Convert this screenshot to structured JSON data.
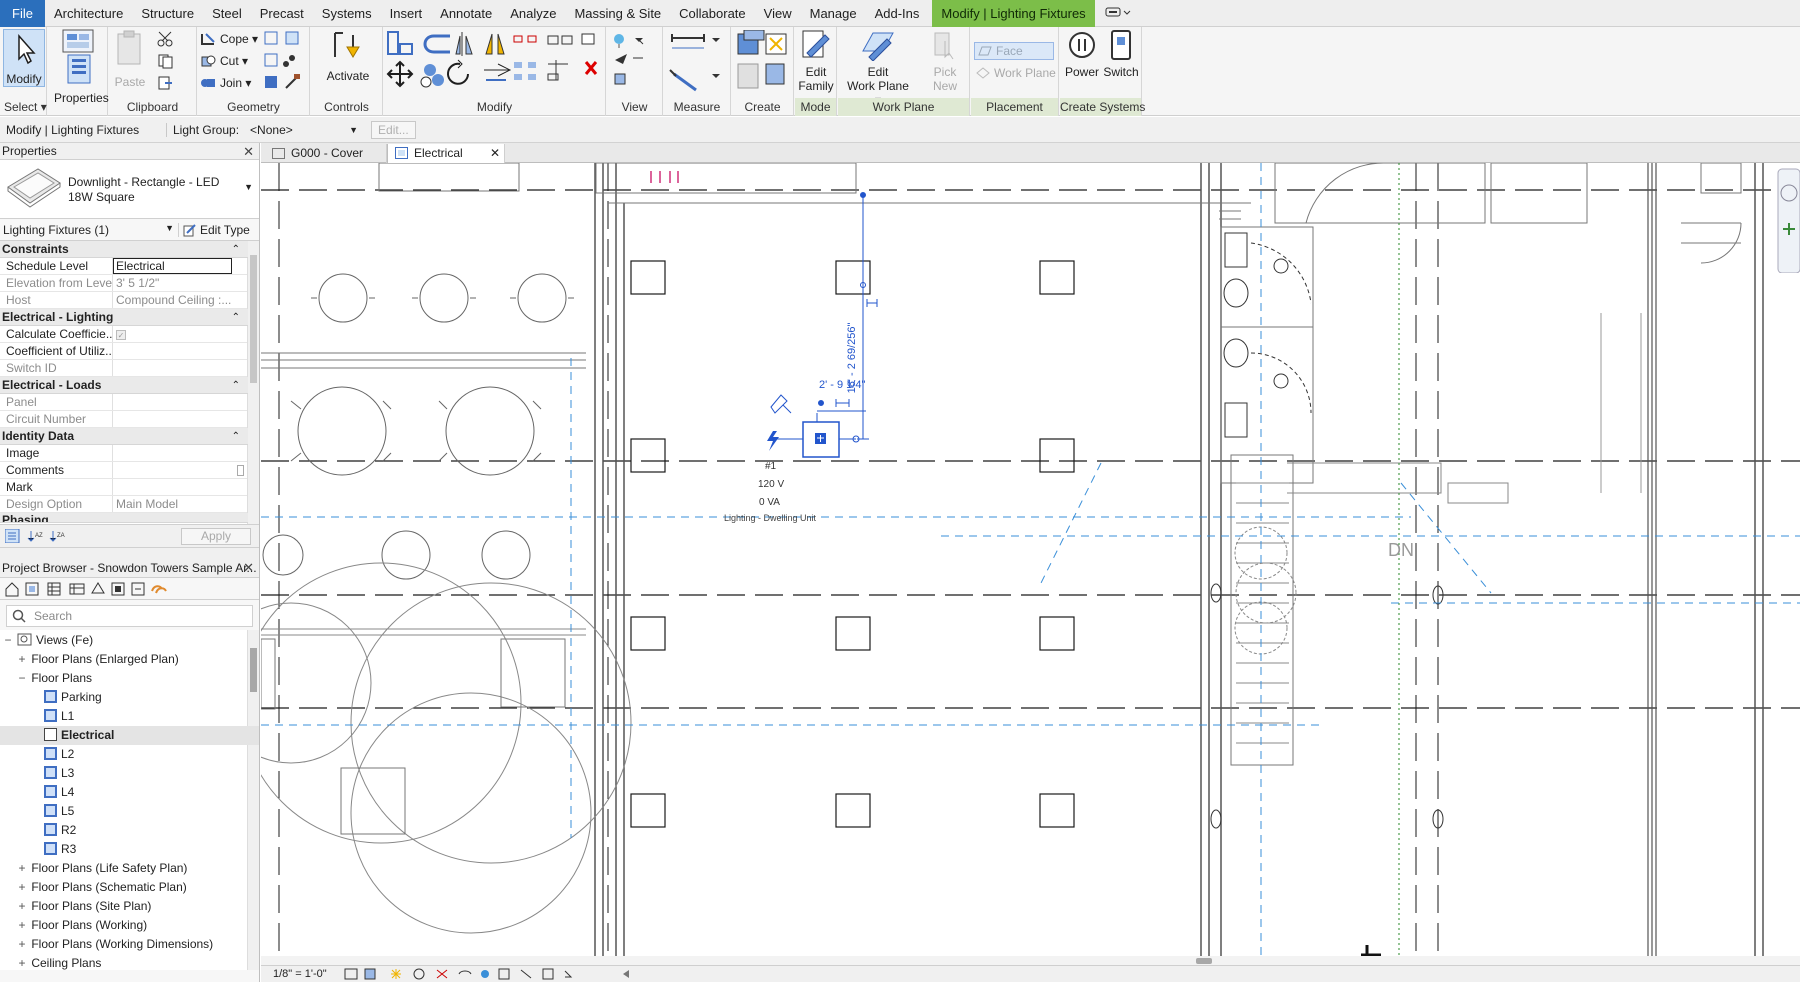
{
  "menu": {
    "tabs": [
      "File",
      "Architecture",
      "Structure",
      "Steel",
      "Precast",
      "Systems",
      "Insert",
      "Annotate",
      "Analyze",
      "Massing & Site",
      "Collaborate",
      "View",
      "Manage",
      "Add-Ins",
      "Modify | Lighting Fixtures"
    ]
  },
  "ribbon": {
    "select": {
      "modify": "Modify",
      "panel": "Select"
    },
    "properties": {
      "label": "Properties",
      "panel": "Properties"
    },
    "clipboard": {
      "paste": "Paste",
      "panel": "Clipboard"
    },
    "geometry": {
      "cope": "Cope",
      "cut": "Cut",
      "join": "Join",
      "panel": "Geometry"
    },
    "controls": {
      "activate": "Activate",
      "panel": "Controls"
    },
    "modify": {
      "panel": "Modify"
    },
    "view": {
      "panel": "View"
    },
    "measure": {
      "panel": "Measure"
    },
    "create": {
      "panel": "Create"
    },
    "mode": {
      "edit_family_1": "Edit",
      "edit_family_2": "Family",
      "panel": "Mode"
    },
    "workplane": {
      "edit_1": "Edit",
      "edit_2": "Work Plane",
      "pick_1": "Pick",
      "pick_2": "New",
      "panel": "Work Plane"
    },
    "placement": {
      "face": "Face",
      "work_plane": "Work Plane",
      "panel": "Placement"
    },
    "create_systems": {
      "power": "Power",
      "switch": "Switch",
      "panel": "Create Systems"
    }
  },
  "options_bar": {
    "context": "Modify | Lighting Fixtures",
    "light_group_label": "Light Group:",
    "light_group_value": "<None>",
    "edit_button": "Edit..."
  },
  "properties": {
    "title": "Properties",
    "type_name_1": "Downlight - Rectangle - LED",
    "type_name_2": "18W Square",
    "filter": "Lighting Fixtures (1)",
    "edit_type": "Edit Type",
    "groups": {
      "constraints": "Constraints",
      "electrical_lighting": "Electrical - Lighting",
      "electrical_loads": "Electrical - Loads",
      "identity": "Identity Data",
      "phasing": "Phasing"
    },
    "rows": {
      "schedule_level": {
        "k": "Schedule Level",
        "v": "Electrical"
      },
      "elevation": {
        "k": "Elevation from Level",
        "v": "3'  5 1/2\""
      },
      "host": {
        "k": "Host",
        "v": "Compound Ceiling :..."
      },
      "calc_coef": {
        "k": "Calculate Coefficie..."
      },
      "coef_util": {
        "k": "Coefficient of Utiliz..."
      },
      "switch_id": {
        "k": "Switch ID"
      },
      "panel": {
        "k": "Panel"
      },
      "circuit": {
        "k": "Circuit Number"
      },
      "image": {
        "k": "Image"
      },
      "comments": {
        "k": "Comments"
      },
      "mark": {
        "k": "Mark"
      },
      "design_option": {
        "k": "Design Option",
        "v": "Main Model"
      }
    },
    "apply": "Apply"
  },
  "browser": {
    "title": "Project Browser - Snowdon Towers Sample Ar...",
    "search_placeholder": "Search",
    "items": [
      {
        "label": "Views (Fe)",
        "pm": "−"
      },
      {
        "label": "Floor Plans (Enlarged Plan)",
        "pm": "+"
      },
      {
        "label": "Floor Plans",
        "pm": "−"
      },
      {
        "label": "Parking"
      },
      {
        "label": "L1"
      },
      {
        "label": "Electrical"
      },
      {
        "label": "L2"
      },
      {
        "label": "L3"
      },
      {
        "label": "L4"
      },
      {
        "label": "L5"
      },
      {
        "label": "R2"
      },
      {
        "label": "R3"
      },
      {
        "label": "Floor Plans (Life Safety Plan)",
        "pm": "+"
      },
      {
        "label": "Floor Plans (Schematic Plan)",
        "pm": "+"
      },
      {
        "label": "Floor Plans (Site Plan)",
        "pm": "+"
      },
      {
        "label": "Floor Plans (Working)",
        "pm": "+"
      },
      {
        "label": "Floor Plans (Working Dimensions)",
        "pm": "+"
      },
      {
        "label": "Ceiling Plans",
        "pm": "+"
      }
    ]
  },
  "view_tabs": [
    "G000 - Cover",
    "Electrical"
  ],
  "canvas": {
    "dim_vertical": "16' - 2 69/256\"",
    "dim_horizontal": "2' - 9 1/4\"",
    "tag_number": "#1",
    "tag_voltage": "120 V",
    "tag_load": "0 VA",
    "tag_type": "Lighting - Dwelling Unit",
    "stair_label": "DN"
  },
  "status": {
    "scale": "1/8\" = 1'-0\""
  },
  "colors": {
    "file_tab": "#2b6fbc",
    "context_tab": "#7cbe49",
    "selection_blue": "#2255cc",
    "grid_dash": "#3a8fd8"
  }
}
